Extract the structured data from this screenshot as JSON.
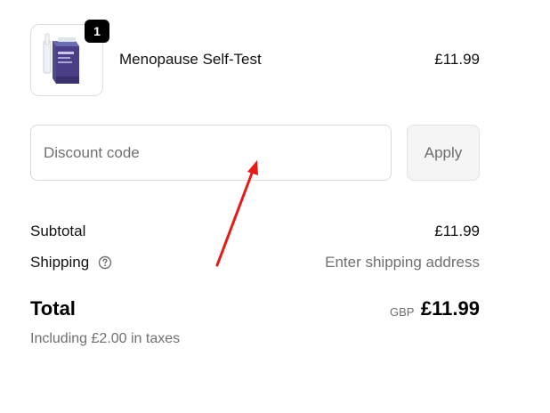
{
  "cart": {
    "items": [
      {
        "quantity": "1",
        "name": "Menopause Self-Test",
        "price": "£11.99",
        "image_icon": "test-kit-box-icon"
      }
    ]
  },
  "discount": {
    "placeholder": "Discount code",
    "value": "",
    "apply_label": "Apply"
  },
  "summary": {
    "subtotal_label": "Subtotal",
    "subtotal_value": "£11.99",
    "shipping_label": "Shipping",
    "shipping_help_icon": "question-circle-icon",
    "shipping_value": "Enter shipping address",
    "total_label": "Total",
    "total_currency": "GBP",
    "total_value": "£11.99",
    "tax_note": "Including £2.00 in taxes"
  },
  "annotation": {
    "icon": "red-arrow-icon",
    "color": "#e41b17"
  },
  "colors": {
    "badge_bg": "#000000",
    "muted_text": "#707070",
    "border": "#d9d9d9",
    "apply_bg": "#f5f5f5"
  }
}
